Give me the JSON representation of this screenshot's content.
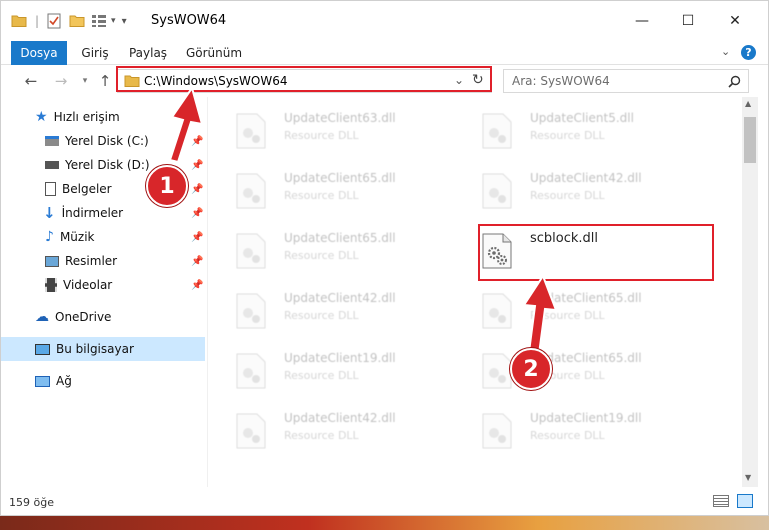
{
  "window": {
    "title": "SysWOW64",
    "controls": {
      "minimize": "—",
      "maximize": "☐",
      "close": "✕"
    }
  },
  "ribbon": {
    "tabs": [
      "Dosya",
      "Giriş",
      "Paylaş",
      "Görünüm"
    ],
    "help": "?"
  },
  "nav": {
    "address": "C:\\Windows\\SysWOW64",
    "search_placeholder": "Ara: SysWOW64"
  },
  "sidebar": {
    "quick_access": "Hızlı erişim",
    "items": [
      {
        "label": "Yerel Disk (C:)",
        "icon": "drive-icon"
      },
      {
        "label": "Yerel Disk (D:)",
        "icon": "drive-icon"
      },
      {
        "label": "Belgeler",
        "icon": "documents-icon"
      },
      {
        "label": "İndirmeler",
        "icon": "download-icon"
      },
      {
        "label": "Müzik",
        "icon": "music-icon"
      },
      {
        "label": "Resimler",
        "icon": "pictures-icon"
      },
      {
        "label": "Videolar",
        "icon": "video-icon"
      }
    ],
    "onedrive": "OneDrive",
    "this_pc": "Bu bilgisayar",
    "network": "Ağ"
  },
  "files": {
    "left": [
      {
        "name": "UpdateClient63.dll",
        "type": "Resource DLL"
      },
      {
        "name": "UpdateClient65.dll",
        "type": "Resource DLL"
      },
      {
        "name": "UpdateClient65.dll",
        "type": "Resource DLL"
      },
      {
        "name": "UpdateClient42.dll",
        "type": "Resource DLL"
      },
      {
        "name": "UpdateClient19.dll",
        "type": "Resource DLL"
      },
      {
        "name": "UpdateClient42.dll",
        "type": "Resource DLL"
      }
    ],
    "right": [
      {
        "name": "UpdateClient5.dll",
        "type": "Resource DLL"
      },
      {
        "name": "UpdateClient42.dll",
        "type": "Resource DLL"
      },
      {
        "name": "scblock.dll",
        "type": ""
      },
      {
        "name": "UpdateClient65.dll",
        "type": "Resource DLL"
      },
      {
        "name": "UpdateClient65.dll",
        "type": "Resource DLL"
      },
      {
        "name": "UpdateClient19.dll",
        "type": "Resource DLL"
      }
    ]
  },
  "status": {
    "count": "159 öğe"
  },
  "annotations": {
    "step1": "1",
    "step2": "2"
  },
  "colors": {
    "accent": "#1979ca",
    "annotation_red": "#e0202a",
    "selected": "#cce8ff"
  }
}
